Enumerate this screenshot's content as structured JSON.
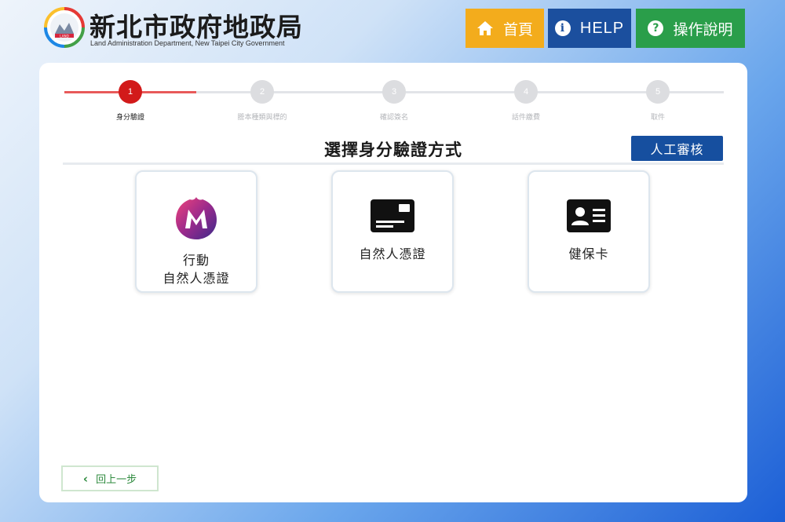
{
  "header": {
    "title": "新北市政府地政局",
    "subtitle": "Land Administration Department, New Taipei City Government",
    "logo_text": "LAND",
    "nav": [
      {
        "label": "首頁",
        "icon": "home-icon",
        "color": "#f3ac1c"
      },
      {
        "label": "HELP",
        "icon": "info-icon",
        "color": "#1b4f9e"
      },
      {
        "label": "操作說明",
        "icon": "question-icon",
        "color": "#2a9e4a"
      }
    ]
  },
  "stepper": {
    "steps": [
      {
        "number": "1",
        "label": "身分驗證",
        "active": true
      },
      {
        "number": "2",
        "label": "謄本種類與標的",
        "active": false
      },
      {
        "number": "3",
        "label": "確認簽名",
        "active": false
      },
      {
        "number": "4",
        "label": "話件繳費",
        "active": false
      },
      {
        "number": "5",
        "label": "取件",
        "active": false
      }
    ],
    "active_color": "#d21a1a"
  },
  "main": {
    "title": "選擇身分驗證方式",
    "manual_button": "人工審核",
    "options": [
      {
        "label_line1": "行動",
        "label_line2": "自然人憑證",
        "icon": "mobile-citizen-certificate-icon"
      },
      {
        "label_line1": "自然人憑證",
        "icon": "citizen-certificate-card-icon"
      },
      {
        "label_line1": "健保卡",
        "icon": "health-insurance-card-icon"
      }
    ]
  },
  "footer": {
    "back_label": "回上一步"
  }
}
